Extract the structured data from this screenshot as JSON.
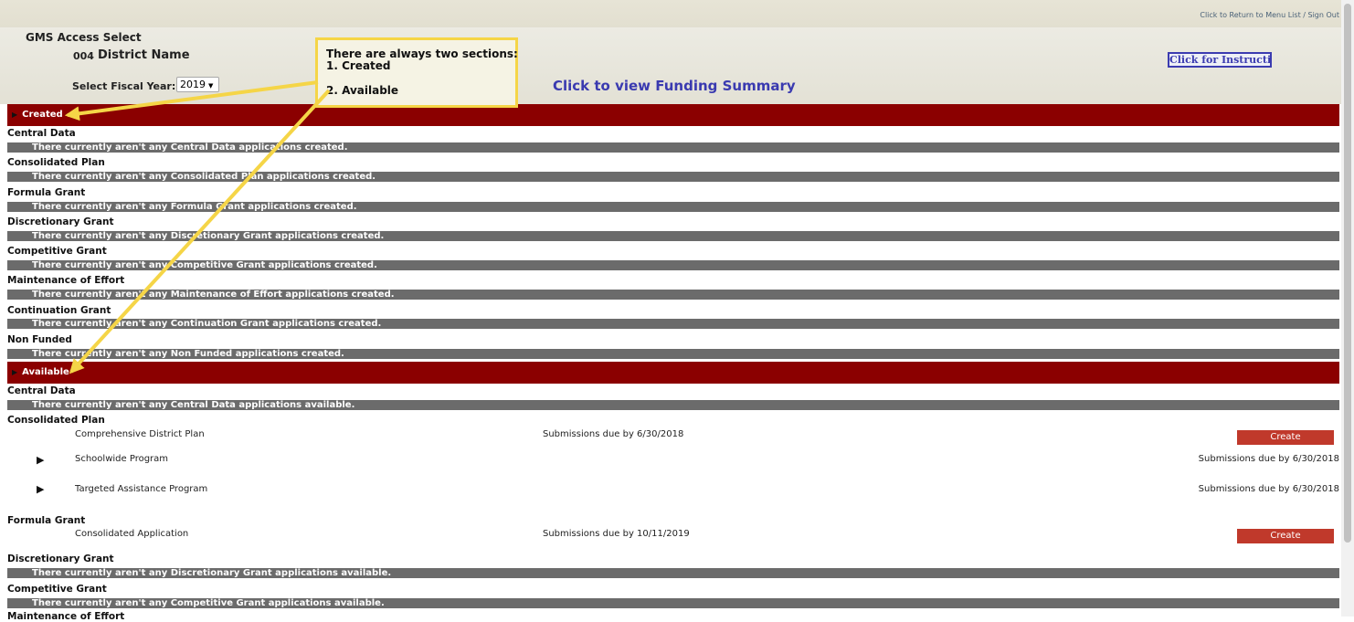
{
  "top_link": "Click to Return to Menu List / Sign Out",
  "header": {
    "title": "GMS Access Select",
    "district_code": "004",
    "district_name": "District Name",
    "fiscal_year_label": "Select Fiscal Year:",
    "fiscal_year_value": "2019",
    "funding_summary_link": "Click to view Funding Summary",
    "instructions_button": "Click for Instructions"
  },
  "callout": {
    "line1": "There are always two sections:",
    "line2": "1. Created",
    "line3": "2. Available",
    "border_color": "#f5d547"
  },
  "created": {
    "label": "Created",
    "rows": [
      {
        "category": "Central Data",
        "message": "There currently aren't any Central Data applications created."
      },
      {
        "category": "Consolidated Plan",
        "message": "There currently aren't any Consolidated Plan applications created."
      },
      {
        "category": "Formula Grant",
        "message": "There currently aren't any Formula Grant applications created."
      },
      {
        "category": "Discretionary Grant",
        "message": "There currently aren't any Discretionary Grant applications created."
      },
      {
        "category": "Competitive Grant",
        "message": "There currently aren't any Competitive Grant applications created."
      },
      {
        "category": "Maintenance of Effort",
        "message": "There currently aren't any Maintenance of Effort applications created."
      },
      {
        "category": "Continuation Grant",
        "message": "There currently aren't any Continuation Grant applications created."
      },
      {
        "category": "Non Funded",
        "message": "There currently aren't any Non Funded applications created."
      }
    ]
  },
  "available": {
    "label": "Available",
    "central_data": {
      "category": "Central Data",
      "message": "There currently aren't any Central Data applications available."
    },
    "consolidated_plan": {
      "category": "Consolidated Plan",
      "comprehensive": {
        "name": "Comprehensive District Plan",
        "due": "Submissions due by 6/30/2018",
        "button": "Create"
      },
      "schoolwide": {
        "name": "Schoolwide Program",
        "due": "Submissions due by 6/30/2018"
      },
      "targeted": {
        "name": "Targeted Assistance Program",
        "due": "Submissions due by 6/30/2018"
      }
    },
    "formula_grant": {
      "category": "Formula Grant",
      "consolidated": {
        "name": "Consolidated Application",
        "due": "Submissions due by 10/11/2019",
        "button": "Create"
      }
    },
    "discretionary": {
      "category": "Discretionary Grant",
      "message": "There currently aren't any Discretionary Grant applications available."
    },
    "competitive": {
      "category": "Competitive Grant",
      "message": "There currently aren't any Competitive Grant applications available."
    },
    "maintenance_partial": "Maintenance of Effort"
  },
  "colors": {
    "section_bar": "#8b0000",
    "message_bar": "#6b6b6b",
    "create_button": "#c0392b",
    "annotation": "#f5d547"
  }
}
